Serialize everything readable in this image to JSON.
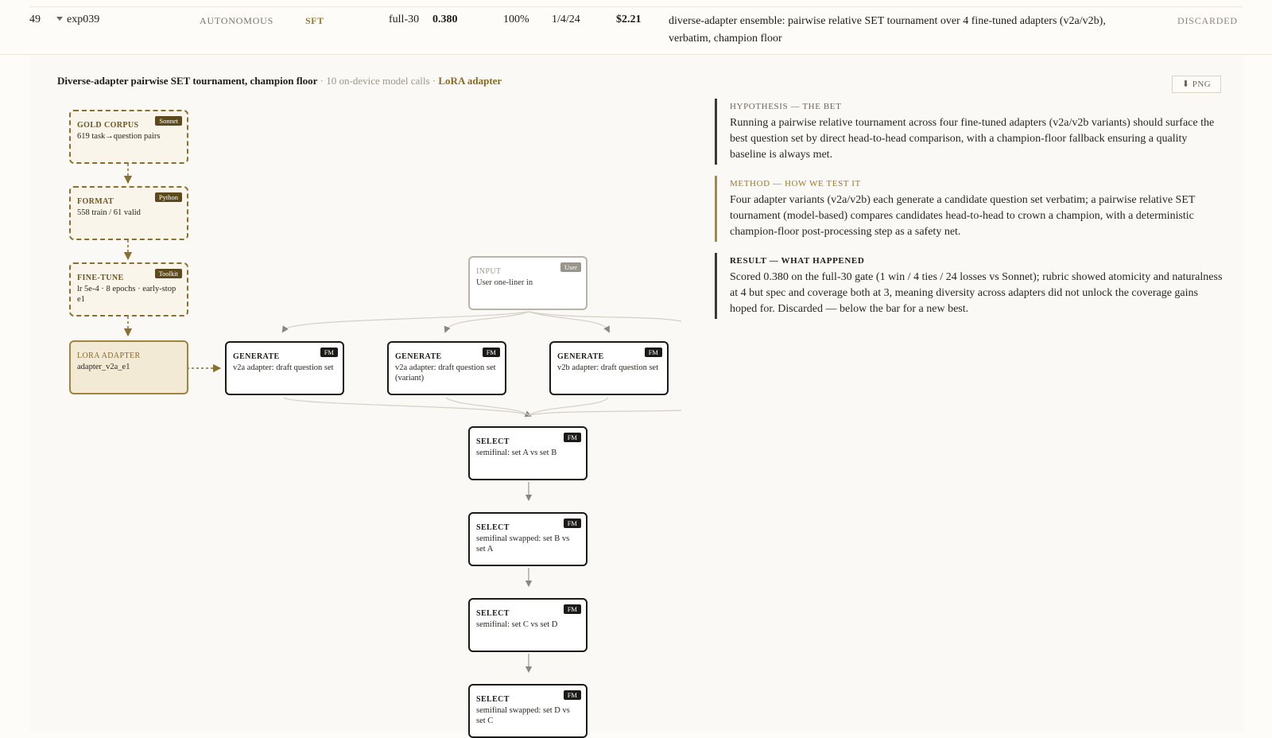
{
  "row": {
    "num": "49",
    "exp_id": "exp039",
    "mode": "AUTONOMOUS",
    "type": "SFT",
    "gate": "full-30",
    "score": "0.380",
    "pct": "100%",
    "record": "1/4/24",
    "cost": "$2.21",
    "description": "diverse-adapter ensemble: pairwise relative SET tournament over 4 fine-tuned adapters (v2a/v2b), verbatim, champion floor",
    "status": "DISCARDED"
  },
  "panel": {
    "title": "Diverse-adapter pairwise SET tournament, champion floor",
    "subtitle": " · 10 on-device model calls · ",
    "link": "LoRA adapter",
    "png_label": "⬇ PNG"
  },
  "pipeline": {
    "gold": {
      "kind": "GOLD CORPUS",
      "badge": "Sonnet",
      "desc": "619 task→question pairs"
    },
    "format": {
      "kind": "FORMAT",
      "badge": "Python",
      "desc": "558 train / 61 valid"
    },
    "finetune": {
      "kind": "FINE-TUNE",
      "badge": "Toolkit",
      "desc": "lr 5e-4 · 8 epochs · early-stop e1"
    },
    "adapter": {
      "kind": "LORA ADAPTER",
      "desc": "adapter_v2a_e1"
    },
    "input": {
      "kind": "INPUT",
      "badge": "User",
      "desc": "User one-liner in"
    },
    "gen1": {
      "kind": "GENERATE",
      "badge": "FM",
      "desc": "v2a adapter: draft question set"
    },
    "gen2": {
      "kind": "GENERATE",
      "badge": "FM",
      "desc": "v2a adapter: draft question set (variant)"
    },
    "gen3": {
      "kind": "GENERATE",
      "badge": "FM",
      "desc": "v2b adapter: draft question set"
    },
    "sel1": {
      "kind": "SELECT",
      "badge": "FM",
      "desc": "semifinal: set A vs set B"
    },
    "sel2": {
      "kind": "SELECT",
      "badge": "FM",
      "desc": "semifinal swapped: set B vs set A"
    },
    "sel3": {
      "kind": "SELECT",
      "badge": "FM",
      "desc": "semifinal: set C vs set D"
    },
    "sel4": {
      "kind": "SELECT",
      "badge": "FM",
      "desc": "semifinal swapped: set D vs set C"
    }
  },
  "notes": {
    "hypothesis": {
      "head": "HYPOTHESIS — THE BET",
      "body": "Running a pairwise relative tournament across four fine-tuned adapters (v2a/v2b variants) should surface the best question set by direct head-to-head comparison, with a champion-floor fallback ensuring a quality baseline is always met."
    },
    "method": {
      "head": "METHOD — HOW WE TEST IT",
      "body": "Four adapter variants (v2a/v2b) each generate a candidate question set verbatim; a pairwise relative SET tournament (model-based) compares candidates head-to-head to crown a champion, with a deterministic champion-floor post-processing step as a safety net."
    },
    "result": {
      "head": "RESULT — WHAT HAPPENED",
      "body": "Scored 0.380 on the full-30 gate (1 win / 4 ties / 24 losses vs Sonnet); rubric showed atomicity and naturalness at 4 but spec and coverage both at 3, meaning diversity across adapters did not unlock the coverage gains hoped for. Discarded — below the bar for a new best."
    }
  },
  "colors": {
    "accent_gold": "#8a6a22",
    "ink": "#1c1a16",
    "panel_bg": "#faf9f5"
  }
}
